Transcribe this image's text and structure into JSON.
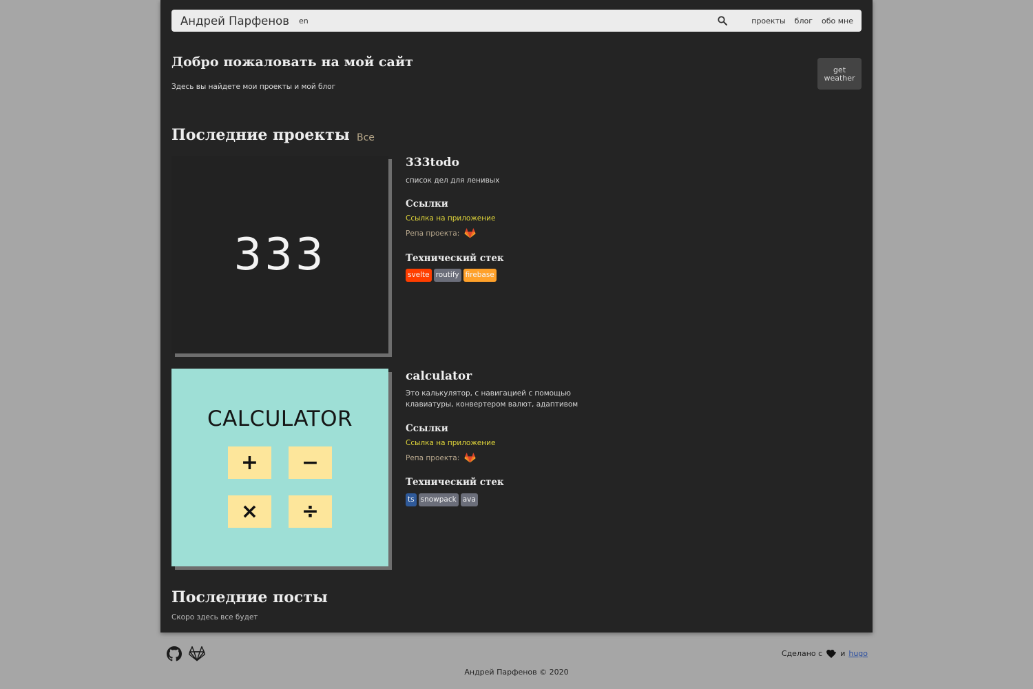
{
  "header": {
    "brand": "Андрей Парфенов",
    "lang": "en",
    "search_icon": "search-icon",
    "nav": [
      "проекты",
      "блог",
      "обо мне"
    ]
  },
  "welcome": {
    "title": "Добро пожаловать на мой сайт",
    "subtitle": "Здесь вы найдете мои проекты и мой блог",
    "weather_button": "get weather"
  },
  "projects_section": {
    "title": "Последние проекты",
    "all_link": "Все"
  },
  "projects": [
    {
      "name": "333todo",
      "thumb_text": "333",
      "description": "список дел для ленивых",
      "links_heading": "Ссылки",
      "app_link": "Ссылка на приложение",
      "repo_label": "Репа проекта:",
      "stack_heading": "Технический стек",
      "tags": [
        {
          "label": "svelte",
          "color": "#ff3e00"
        },
        {
          "label": "routify",
          "color": "#6b6e7a"
        },
        {
          "label": "firebase",
          "color": "#ffa12a"
        }
      ]
    },
    {
      "name": "calculator",
      "thumb_text": "CALCULATOR",
      "thumb_keys": [
        "+",
        "−",
        "×",
        "÷"
      ],
      "description": "Это калькулятор, с навигацией с помощью клавиатуры, конвертером валют, адаптивом",
      "links_heading": "Ссылки",
      "app_link": "Ссылка на приложение",
      "repo_label": "Репа проекта:",
      "stack_heading": "Технический стек",
      "tags": [
        {
          "label": "ts",
          "color": "#2f5a9a"
        },
        {
          "label": "snowpack",
          "color": "#6b6e7a"
        },
        {
          "label": "ava",
          "color": "#6b6e7a"
        }
      ]
    }
  ],
  "posts_section": {
    "title": "Последние посты",
    "subtitle": "Скоро здесь все будет"
  },
  "footer": {
    "made_with": "Сделано с",
    "and": "и",
    "hugo": "hugo",
    "copyright": "Андрей Парфенов © 2020",
    "icons": [
      "github-icon",
      "gitlab-icon",
      "heart-icon"
    ]
  },
  "colors": {
    "page_bg": "#a6a6a6",
    "panel_bg": "#242424",
    "link_yellow": "#e1d63a",
    "gitlab_orange": "#e24329",
    "calc_bg": "#9edfd6",
    "calc_key": "#fde69b"
  }
}
